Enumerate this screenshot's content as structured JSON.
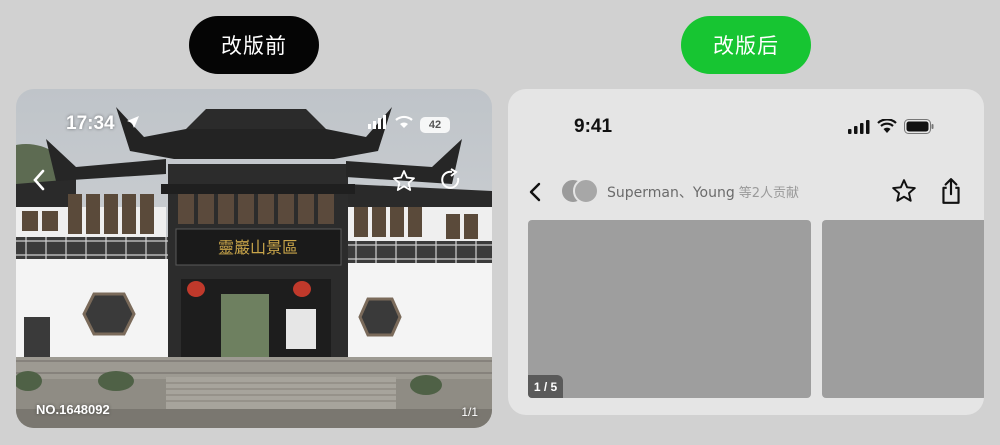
{
  "labels": {
    "before": "改版前",
    "after": "改版后"
  },
  "before_screen": {
    "time": "17:34",
    "battery": "42",
    "photo_number": "NO.1648092",
    "page_indicator": "1/1",
    "sign_text": "靈巖山景區",
    "icons": [
      "location-arrow-icon",
      "signal-icon",
      "wifi-icon",
      "battery-icon",
      "back-icon",
      "star-icon",
      "share-icon"
    ]
  },
  "after_screen": {
    "time": "9:41",
    "contributors": "Superman、Young",
    "contributors_suffix": "等2人贡献",
    "image_counter": "1 / 5",
    "icons": [
      "signal-icon",
      "wifi-icon",
      "battery-icon",
      "back-icon",
      "star-icon",
      "share-icon"
    ]
  },
  "colors": {
    "background": "#d1d1d1",
    "before_pill": "#050505",
    "after_pill": "#17c532",
    "placeholder": "#9e9e9e"
  }
}
